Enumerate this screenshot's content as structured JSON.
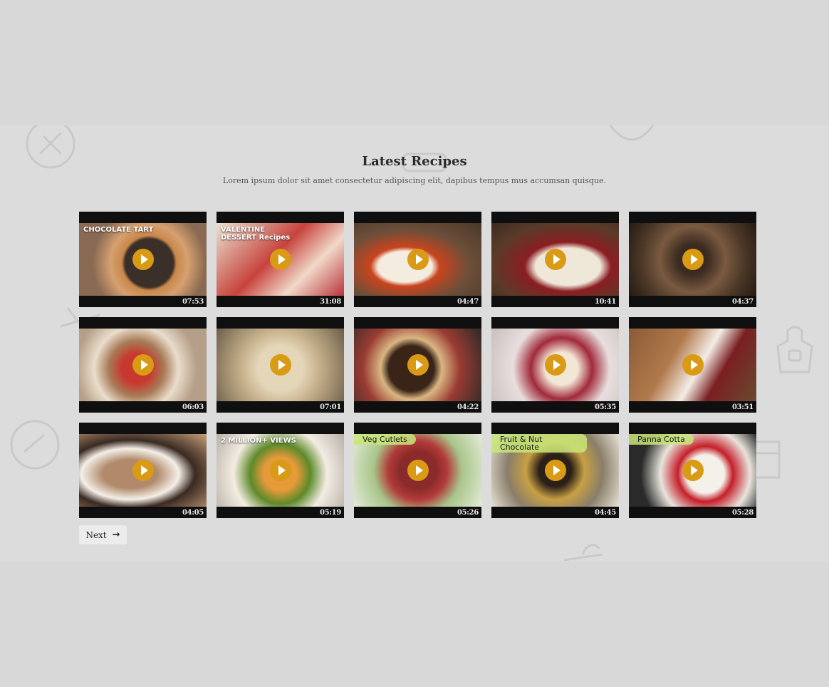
{
  "section": {
    "title": "Latest Recipes",
    "subtitle": "Lorem ipsum dolor sit amet consectetur adipiscing elit, dapibus tempus mus accumsan quisque."
  },
  "videos": [
    {
      "caption": "CHOCOLATE TART",
      "duration": "07:53"
    },
    {
      "caption": "VALENTINE DESSERT Recipes",
      "duration": "31:08"
    },
    {
      "caption": "",
      "duration": "04:47"
    },
    {
      "caption": "",
      "duration": "10:41"
    },
    {
      "caption": "",
      "duration": "04:37"
    },
    {
      "caption": "",
      "duration": "06:03"
    },
    {
      "caption": "",
      "duration": "07:01"
    },
    {
      "caption": "",
      "duration": "04:22"
    },
    {
      "caption": "",
      "duration": "05:35"
    },
    {
      "caption": "",
      "duration": "03:51"
    },
    {
      "caption": "",
      "duration": "04:05"
    },
    {
      "caption": "2 MILLION+ VIEWS",
      "duration": "05:19"
    },
    {
      "caption": "Veg Cutlets",
      "duration": "05:26"
    },
    {
      "caption": "Fruit & Nut Chocolate",
      "duration": "04:45"
    },
    {
      "caption": "Panna Cotta",
      "duration": "05:28"
    }
  ],
  "pagination": {
    "next_label": "Next",
    "next_icon": "arrow-right-icon"
  },
  "colors": {
    "accent": "#d99a16",
    "background": "#d8d8d8",
    "card": "#0f0f0f"
  }
}
